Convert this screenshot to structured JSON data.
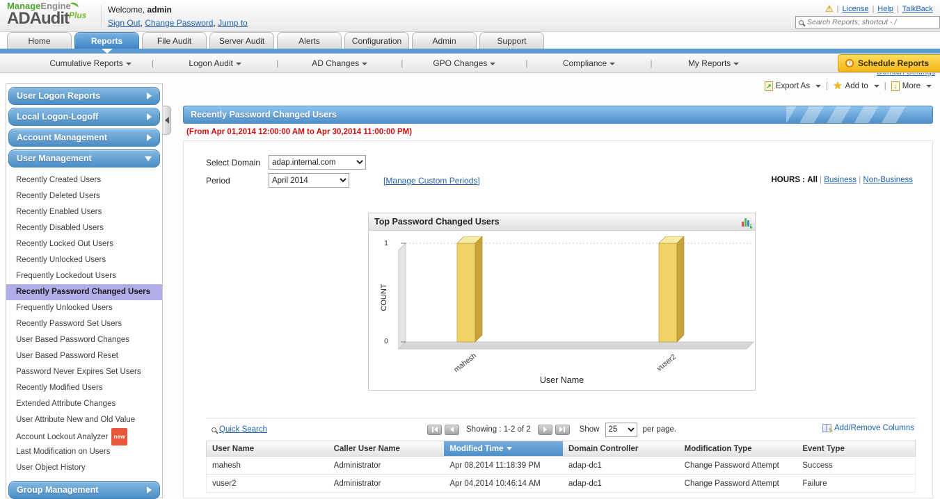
{
  "header": {
    "brand_manage": "Manage",
    "brand_engine": "Engine",
    "product": "ADAudit",
    "product_plus": "Plus",
    "welcome_label": "Welcome,",
    "username": "admin",
    "sign_out": "Sign Out",
    "change_password": "Change Password",
    "jump_to": "Jump to",
    "license": "License",
    "help": "Help",
    "talkback": "TalkBack",
    "search_placeholder": "Search Reports; shortcut - /"
  },
  "icons": {
    "warning": "⚠",
    "star": "★",
    "export_arrow": "↗",
    "more_arrow": "↓"
  },
  "tabs": {
    "items": [
      "Home",
      "Reports",
      "File Audit",
      "Server Audit",
      "Alerts",
      "Configuration",
      "Admin",
      "Support"
    ],
    "active": "Reports"
  },
  "domain_settings": "Domain Settings",
  "subnav": {
    "items": [
      "Cumulative Reports",
      "Logon Audit",
      "AD Changes",
      "GPO Changes",
      "Compliance",
      "My Reports"
    ],
    "schedule_reports": "Schedule Reports"
  },
  "sidebar": {
    "sections": [
      "User Logon Reports",
      "Local Logon-Logoff",
      "Account Management",
      "User Management"
    ],
    "expanded_section": "User Management",
    "items": [
      "Recently Created Users",
      "Recently Deleted Users",
      "Recently Enabled Users",
      "Recently Disabled Users",
      "Recently Locked Out Users",
      "Recently Unlocked Users",
      "Frequently Lockedout Users",
      "Recently Password Changed Users",
      "Frequently Unlocked Users",
      "Recently Password Set Users",
      "User Based Password Changes",
      "User Based Password Reset",
      "Password Never Expires Set Users",
      "Recently Modified Users",
      "Extended Attribute Changes",
      "User Attribute New and Old Value",
      "Account Lockout Analyzer",
      "Last Modification on Users",
      "User Object History"
    ],
    "selected_item": "Recently Password Changed Users",
    "new_badge": "new",
    "bottom_section": "Group Management"
  },
  "actions": {
    "export_as": "Export As",
    "add_to": "Add to",
    "more": "More"
  },
  "report": {
    "title": "Recently Password Changed Users",
    "date_range": "(From Apr 01,2014 12:00:00 AM to Apr 30,2014 11:00:00 PM)",
    "select_domain_label": "Select Domain",
    "domain_value": "adap.internal.com",
    "period_label": "Period",
    "period_value": "April 2014",
    "manage_custom_periods": "[Manage Custom Periods]",
    "hours_label": "HOURS :",
    "hours_all": "All",
    "hours_business": "Business",
    "hours_non_business": "Non-Business"
  },
  "chart_data": {
    "type": "bar",
    "title": "Top Password Changed Users",
    "categories": [
      "mahesh",
      "vuser2"
    ],
    "values": [
      1,
      1
    ],
    "xlabel": "User Name",
    "ylabel": "COUNT",
    "ylim": [
      0,
      1
    ],
    "yticks": [
      0,
      1
    ],
    "legend": "none",
    "style": "3d-bars",
    "bar_color": "#f1d264",
    "grid": "dotted line at y=1"
  },
  "table": {
    "quick_search": "Quick Search",
    "pager": {
      "showing": "Showing :",
      "range": "1-2 of 2",
      "show": "Show",
      "page_size": "25",
      "per_page": "per page."
    },
    "add_remove_columns": "Add/Remove Columns",
    "columns": [
      "User Name",
      "Caller User Name",
      "Modified Time",
      "Domain Controller",
      "Modification Type",
      "Event Type"
    ],
    "sort_column": "Modified Time",
    "sort_direction": "desc",
    "rows": [
      [
        "mahesh",
        "Administrator",
        "Apr 08,2014 11:18:39 PM",
        "adap-dc1",
        "Change Password Attempt",
        "Success"
      ],
      [
        "vuser2",
        "Administrator",
        "Apr 04,2014 10:46:14 AM",
        "adap-dc1",
        "Change Password Attempt",
        "Failure"
      ]
    ]
  }
}
